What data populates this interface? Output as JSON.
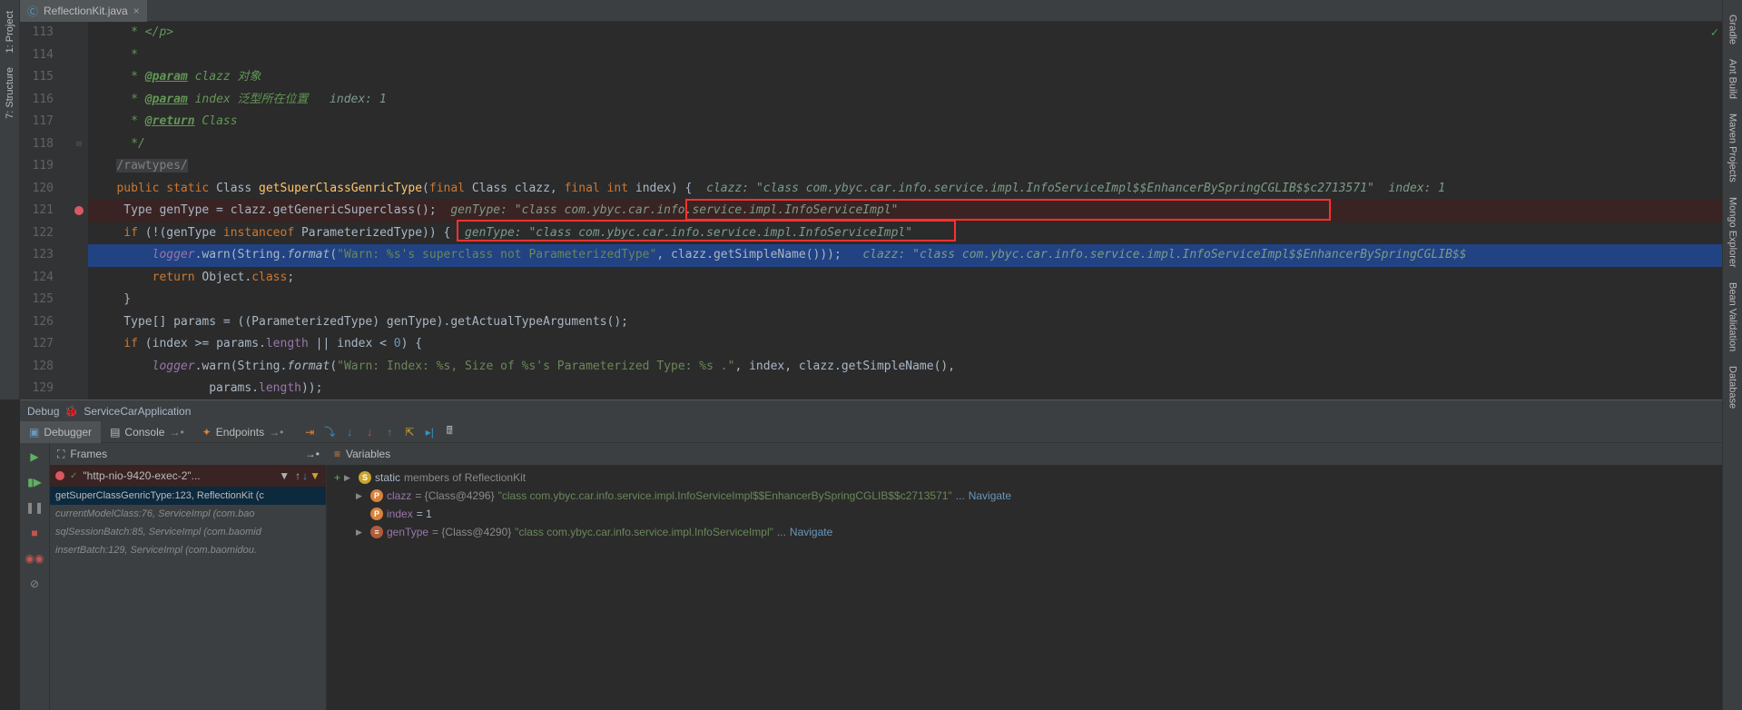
{
  "tab": {
    "filename": "ReflectionKit.java"
  },
  "leftTools": [
    "1: Project",
    "7: Structure"
  ],
  "rightTools": [
    "Gradle",
    "Ant Build",
    "Maven Projects",
    "Mongo Explorer",
    "Bean Validation",
    "Database"
  ],
  "gutter": [
    "113",
    "114",
    "115",
    "116",
    "117",
    "118",
    "119",
    "120",
    "121",
    "122",
    "123",
    "124",
    "125",
    "126",
    "127",
    "128",
    "129"
  ],
  "code": {
    "l113": " * </p>",
    "l114": " *",
    "l115a": " * ",
    "l115b": "@param",
    "l115c": " clazz 对象",
    "l116a": " * ",
    "l116b": "@param",
    "l116c": " index 泛型所在位置   ",
    "l116d": "index: 1",
    "l117a": " * ",
    "l117b": "@return",
    "l117c": " Class",
    "l118": " */",
    "l119": "/rawtypes/",
    "l120a": "public static ",
    "l120b": "Class ",
    "l120c": "getSuperClassGenricType",
    "l120d": "(",
    "l120e": "final ",
    "l120f": "Class clazz, ",
    "l120g": "final int ",
    "l120h": "index) {  ",
    "l120hint": "clazz: \"class com.ybyc.car.info.service.impl.InfoServiceImpl$$EnhancerBySpringCGLIB$$c2713571\"  index: 1",
    "l121a": "    Type genType = clazz.getGenericSuperclass();  ",
    "l121hint": "genType: \"class com.ybyc.car.info.service.impl.InfoServiceImpl\"",
    "l122a": "    if ",
    "l122b": "(!(genType ",
    "l122c": "instanceof ",
    "l122d": "ParameterizedType)) {  ",
    "l122hint": "genType: \"class com.ybyc.car.info.service.impl.InfoServiceImpl\"",
    "l123a": "        ",
    "l123b": "logger",
    "l123c": ".warn(String.",
    "l123d": "format",
    "l123e": "(",
    "l123f": "\"Warn: %s's superclass not ParameterizedType\"",
    "l123g": ", clazz.getSimpleName()));   ",
    "l123hint": "clazz: \"class com.ybyc.car.info.service.impl.InfoServiceImpl$$EnhancerBySpringCGLIB$$",
    "l124a": "        return ",
    "l124b": "Object.",
    "l124c": "class",
    "l124d": ";",
    "l125": "    }",
    "l126": "    Type[] params = ((ParameterizedType) genType).getActualTypeArguments();",
    "l127a": "    if ",
    "l127b": "(index >= params.",
    "l127c": "length ",
    "l127d": "|| index < ",
    "l127e": "0",
    "l127f": ") {",
    "l128a": "        ",
    "l128b": "logger",
    "l128c": ".warn(String.",
    "l128d": "format",
    "l128e": "(",
    "l128f": "\"Warn: Index: %s, Size of %s's Parameterized Type: %s .\"",
    "l128g": ", index, clazz.getSimpleName(),",
    "l129a": "                params.",
    "l129b": "length",
    "l129c": "));"
  },
  "debug": {
    "title": "Debug",
    "config": "ServiceCarApplication",
    "tabs": {
      "debugger": "Debugger",
      "console": "Console",
      "endpoints": "Endpoints"
    },
    "framesLabel": "Frames",
    "varsLabel": "Variables",
    "thread": "\"http-nio-9420-exec-2\"...",
    "frames": [
      "getSuperClassGenricType:123, ReflectionKit (c",
      "currentModelClass:76, ServiceImpl (com.bao",
      "sqlSessionBatch:85, ServiceImpl (com.baomid",
      "insertBatch:129, ServiceImpl (com.baomidou."
    ],
    "vars": {
      "staticLabel": "static",
      "staticOf": " members of ReflectionKit",
      "clazzName": "clazz",
      "clazzMeta": " = {Class@4296} ",
      "clazzVal": "\"class com.ybyc.car.info.service.impl.InfoServiceImpl$$EnhancerBySpringCGLIB$$c2713571\"",
      "clazzDots": "... ",
      "indexName": "index",
      "indexVal": " = 1",
      "genName": "genType",
      "genMeta": " = {Class@4290} ",
      "genVal": "\"class com.ybyc.car.info.service.impl.InfoServiceImpl\"",
      "genDots": "... ",
      "nav": "Navigate"
    }
  }
}
